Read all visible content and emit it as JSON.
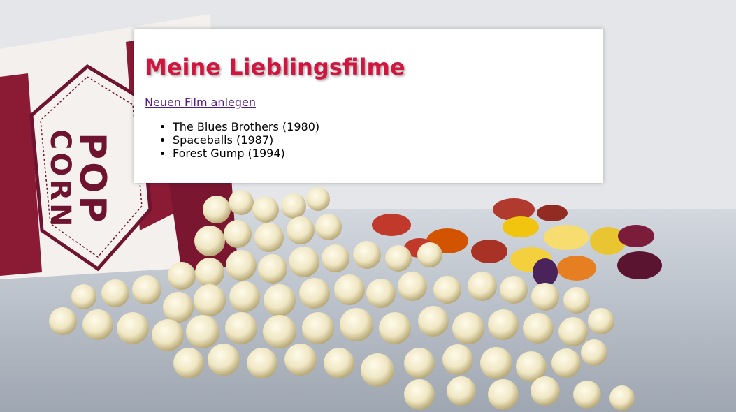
{
  "page": {
    "title": "Meine Lieblingsfilme"
  },
  "actions": {
    "new_movie_link": "Neuen Film anlegen"
  },
  "movies": [
    {
      "label": "The Blues Brothers (1980)"
    },
    {
      "label": "Spaceballs (1987)"
    },
    {
      "label": "Forest Gump (1994)"
    }
  ],
  "background": {
    "icon": "popcorn-and-gummy-bears-photo",
    "box_label": "POP CORN"
  }
}
